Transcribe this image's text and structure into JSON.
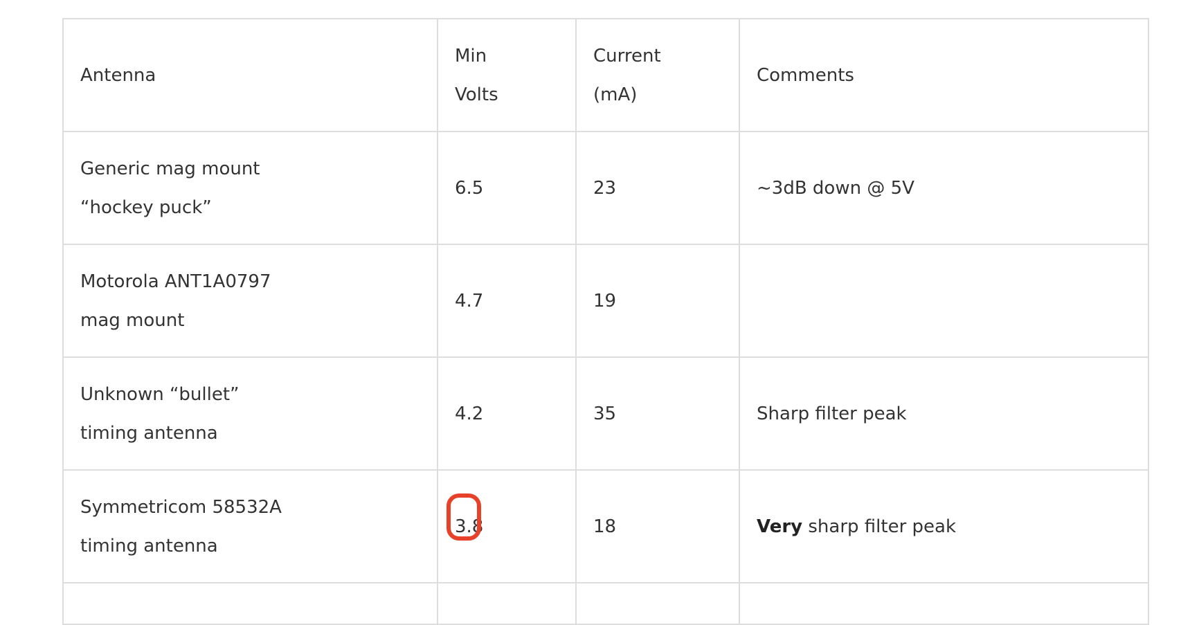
{
  "table": {
    "headers": {
      "antenna": "Antenna",
      "min_volts_1": "Min",
      "min_volts_2": "Volts",
      "current_1": "Current",
      "current_2": "(mA)",
      "comments": "Comments"
    },
    "rows": [
      {
        "antenna_1": "Generic mag mount",
        "antenna_2": "“hockey puck”",
        "min_volts": "6.5",
        "current": "23",
        "comment_bold": "",
        "comment": "~3dB down @ 5V"
      },
      {
        "antenna_1": "Motorola ANT1A0797",
        "antenna_2": "mag mount",
        "min_volts": "4.7",
        "current": "19",
        "comment_bold": "",
        "comment": ""
      },
      {
        "antenna_1": "Unknown “bullet”",
        "antenna_2": "timing antenna",
        "min_volts": "4.2",
        "current": "35",
        "comment_bold": "",
        "comment": "Sharp filter peak"
      },
      {
        "antenna_1": "Symmetricom 58532A",
        "antenna_2": "timing antenna",
        "min_volts": "3.8",
        "current": "18",
        "comment_bold": "Very",
        "comment": " sharp filter peak"
      }
    ]
  },
  "highlight": {
    "color": "#e8412a"
  }
}
